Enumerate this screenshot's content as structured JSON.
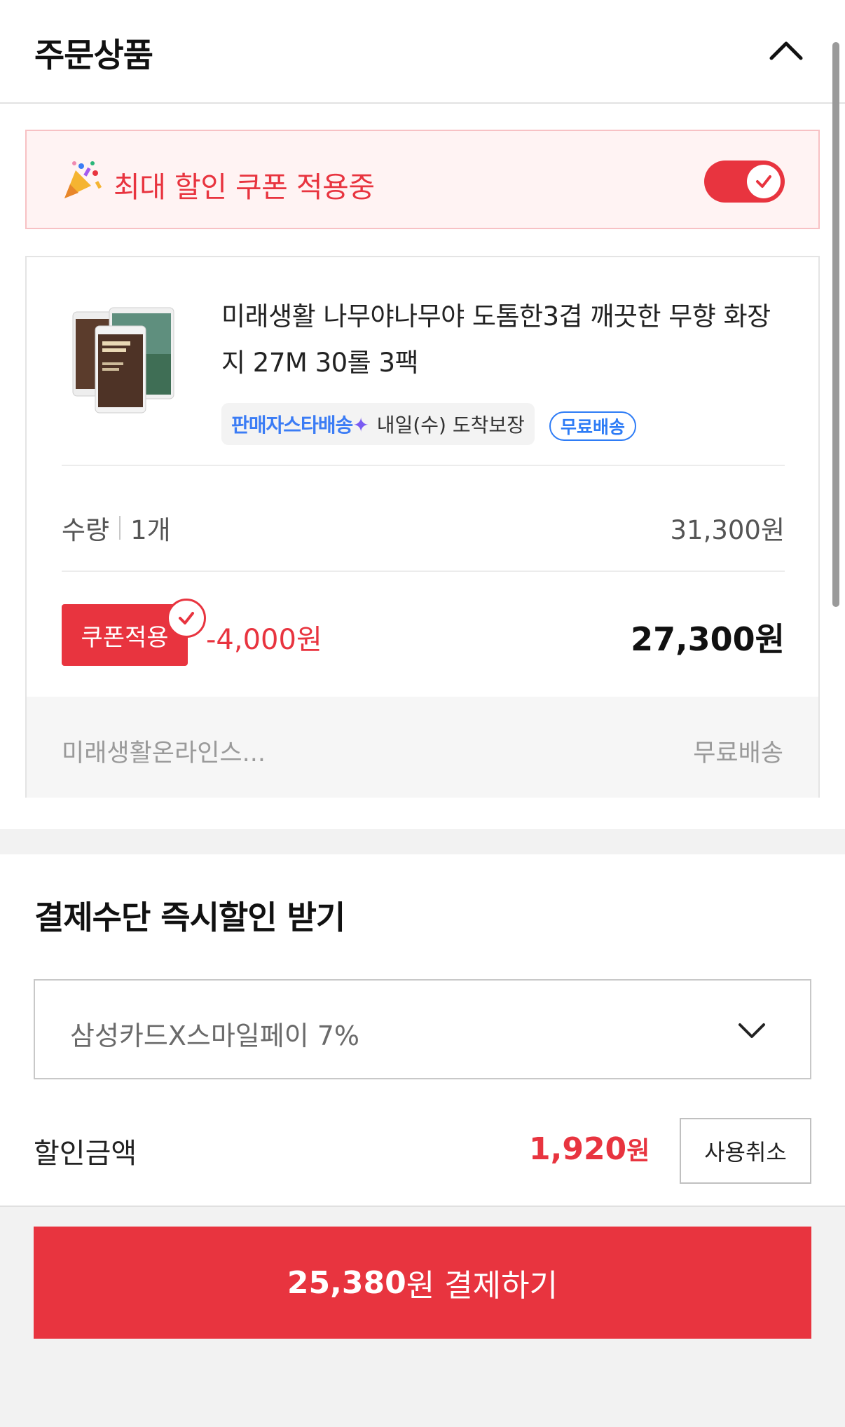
{
  "header": {
    "title": "주문상품"
  },
  "coupon_banner": {
    "text": "최대 할인 쿠폰 적용중",
    "enabled": true
  },
  "product": {
    "name": "미래생활 나무야나무야 도톰한3겹 깨끗한 무향 화장지 27M 30롤 3팩",
    "delivery_service": "판매자스타배송",
    "arrival": "내일(수) 도착보장",
    "shipping_badge": "무료배송",
    "quantity_label": "수량",
    "quantity_value": "1개",
    "original_price": "31,300원",
    "coupon_badge": "쿠폰적용",
    "coupon_discount": "-4,000원",
    "final_price": "27,300원",
    "seller": "미래생활온라인스...",
    "seller_shipping": "무료배송"
  },
  "payment": {
    "title": "결제수단 즉시할인 받기",
    "selected_card": "삼성카드X스마일페이 7%",
    "discount_label": "할인금액",
    "discount_value": "1,920",
    "discount_unit": "원",
    "cancel_label": "사용취소"
  },
  "footer": {
    "pay_amount": "25,380",
    "pay_suffix": "원 결제하기"
  },
  "colors": {
    "accent": "#e8343f",
    "blue": "#2e7cf6"
  },
  "icons": {
    "header": "chevron-up-icon",
    "banner": "party-popper-icon",
    "toggle": "check-icon",
    "select": "chevron-down-icon"
  }
}
